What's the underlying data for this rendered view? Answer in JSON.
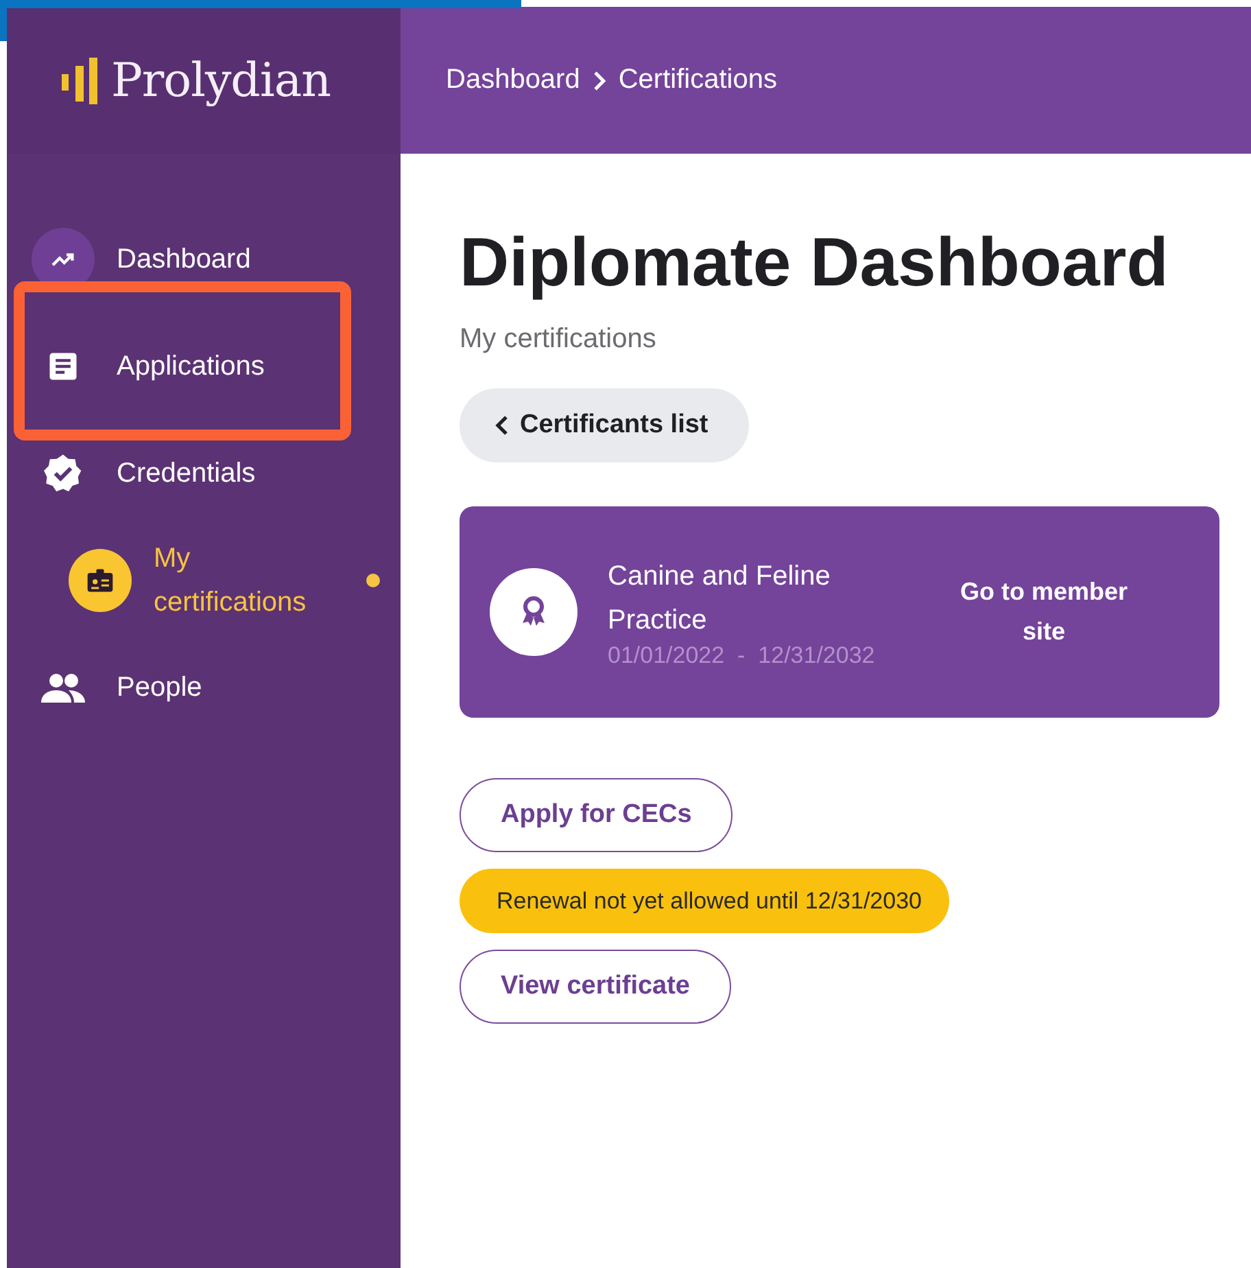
{
  "sidebar": {
    "logo": "Prolydian",
    "items": [
      {
        "label": "Dashboard",
        "kind": "trend",
        "selected": false,
        "hovered": true
      },
      {
        "label": "Applications",
        "kind": "doc",
        "selected": false,
        "hovered": false,
        "highlighted": true
      },
      {
        "label": "Credentials",
        "kind": "badge",
        "selected": false,
        "hovered": false,
        "children": [
          {
            "label": "My certifications",
            "kind": "id",
            "selected": true
          }
        ]
      },
      {
        "label": "People",
        "kind": "people",
        "selected": false,
        "hovered": false
      }
    ]
  },
  "breadcrumb": [
    "Dashboard",
    "Certifications"
  ],
  "page": {
    "title": "Diplomate Dashboard",
    "subtitle": "My certifications",
    "back_button": "Certificants list"
  },
  "certificate": {
    "name": "Canine and Feline Practice",
    "start": "01/01/2022",
    "separator": "-",
    "end": "12/31/2032",
    "link": "Go to member site"
  },
  "actions": [
    {
      "kind": "button",
      "label": "Apply for CECs"
    },
    {
      "kind": "notice",
      "label": "Renewal not yet allowed until 12/31/2030"
    },
    {
      "kind": "button",
      "label": "View certificate"
    }
  ]
}
